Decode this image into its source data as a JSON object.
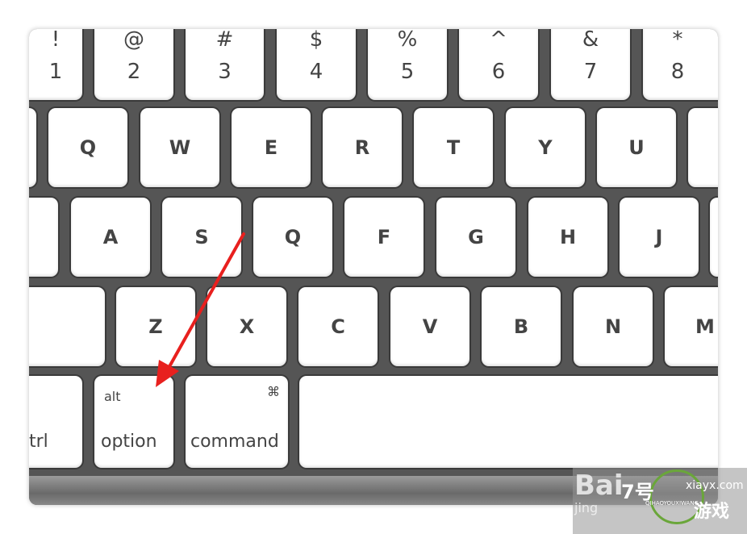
{
  "keyboard": {
    "row1": [
      {
        "top": "!",
        "bottom": "1"
      },
      {
        "top": "@",
        "bottom": "2"
      },
      {
        "top": "#",
        "bottom": "3"
      },
      {
        "top": "$",
        "bottom": "4"
      },
      {
        "top": "%",
        "bottom": "5"
      },
      {
        "top": "^",
        "bottom": "6"
      },
      {
        "top": "&",
        "bottom": "7"
      },
      {
        "top": "*",
        "bottom": "8"
      }
    ],
    "row2": [
      "Q",
      "W",
      "E",
      "R",
      "T",
      "Y",
      "U"
    ],
    "row3": [
      "A",
      "S",
      "Q",
      "F",
      "G",
      "H",
      "J"
    ],
    "row4": [
      "Z",
      "X",
      "C",
      "V",
      "B",
      "N",
      "M"
    ],
    "ctrl": "trl",
    "option": {
      "top": "alt",
      "label": "option"
    },
    "command": {
      "symbol": "⌘",
      "label": "command"
    }
  },
  "annotation": {
    "arrow_color": "#e8201e",
    "points_to": "option"
  },
  "watermark": {
    "baidu": "Bai",
    "jingyan": "jing",
    "site": "xiayx.com",
    "logo": "7号",
    "logo_sub": "QIHAOYOUXIWANG",
    "name": "游戏"
  }
}
